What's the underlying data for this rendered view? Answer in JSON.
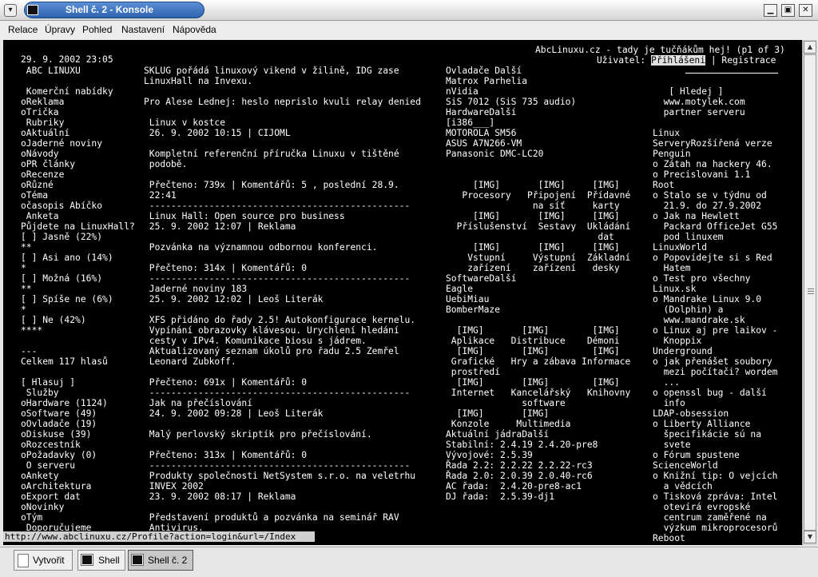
{
  "window": {
    "title": "Shell č. 2 - Konsole"
  },
  "menu": [
    "Relace",
    "Úpravy",
    "Pohled",
    "Nastavení",
    "Nápověda"
  ],
  "taskbar": {
    "new_label": "Vytvořit",
    "tabs": [
      "Shell",
      "Shell č. 2"
    ]
  },
  "status_url": "http://www.abclinuxu.cz/Profile?action=login&url=/Index",
  "header": {
    "site": "AbcLinuxu.cz - tady je tučňákům hej! (p1 of 3)",
    "date": "29. 9. 2002 23:05",
    "user_label": "Uživatel: ",
    "login": "Přihlášeni",
    "register": " | Registrace"
  },
  "left": [
    " ABC LINUXU",
    "",
    " Komerční nabídky",
    "oReklama",
    "oTrička",
    " Rubriky",
    "oAktuální",
    "oJaderné noviny",
    "oNávody",
    "oPR články",
    "oRecenze",
    "oRůzné",
    "oTéma",
    "očasopis Abíčko",
    " Anketa",
    "Půjdete na LinuxHall?",
    "[ ] Jasně (22%)",
    "**",
    "[ ] Asi ano (14%)",
    "*",
    "[ ] Možná (16%)",
    "**",
    "[ ] Spíše ne (6%)",
    "*",
    "[ ] Ne (42%)",
    "****",
    "",
    "---",
    "Celkem 117 hlasů",
    "",
    "[ Hlasuj ]",
    " Služby",
    "oHardware (1124)",
    "oSoftware (49)",
    "oOvladače (19)",
    "oDiskuse (39)",
    "oRozcestník",
    "oPožadavky (0)",
    " O serveru",
    "oAnkety",
    "oArchitektura",
    "oExport dat",
    "oNovinky",
    "oTým",
    " Doporučujeme"
  ],
  "center": [
    "SKLUG pořádá linuxový vikend v žilině, IDG zase",
    "LinuxHall na Invexu.",
    "",
    "Pro Alese Lednej: heslo neprislo kvuli relay denied",
    "",
    " Linux v kostce",
    " 26. 9. 2002 10:15 | CIJOML",
    "",
    " Kompletní referenční příručka Linuxu v tištěné",
    " podobě.",
    "",
    " Přečteno: 739x | Komentářů: 5 , poslední 28.9.",
    " 22:41",
    " ------------------------------------------------",
    " Linux Hall: Open source pro business",
    " 25. 9. 2002 12:07 | Reklama",
    "",
    " Pozvánka na významnou odbornou konferenci.",
    "",
    " Přečteno: 314x | Komentářů: 0",
    " ------------------------------------------------",
    " Jaderné noviny 183",
    " 25. 9. 2002 12:02 | Leoš Literák",
    "",
    " XFS přidáno do řady 2.5! Autokonfigurace kernelu.",
    " Vypínání obrazovky klávesou. Urychlení hledání",
    " cesty v IPv4. Komunikace biosu s jádrem.",
    " Aktualizovaný seznam úkolů pro řadu 2.5 Zemřel",
    " Leonard Zubkoff.",
    "",
    " Přečteno: 691x | Komentářů: 0",
    " ------------------------------------------------",
    " Jak na přečíslování",
    " 24. 9. 2002 09:28 | Leoš Literák",
    "",
    " Malý perlovský skriptík pro přečíslování.",
    "",
    " Přečteno: 313x | Komentářů: 0",
    " ------------------------------------------------",
    " Produkty společnosti NetSystem s.r.o. na veletrhu",
    " INVEX 2002",
    " 23. 9. 2002 08:17 | Reklama",
    "",
    " Představení produktů a pozvánka na seminář RAV",
    " Antivirus."
  ],
  "hw": [
    "Ovladače Další",
    "Matrox Parhelia",
    "nVidia",
    "SiS 7012 (SiS 735 audio)",
    "HardwareDalší",
    "[i386___]",
    "MOTOROLA SM56",
    "ASUS A7N266-VM",
    "Panasonic DMC-LC20",
    "",
    "",
    "     [IMG]       [IMG]     [IMG]",
    "   Procesory   Připojení  Přídavné",
    "                na síť     karty",
    "     [IMG]       [IMG]     [IMG]",
    "  Příslušenství  Sestavy  Ukládání",
    "                            dat",
    "     [IMG]       [IMG]     [IMG]",
    "    Vstupní     Výstupní  Základní",
    "    zařízení    zařízení   desky",
    "SoftwareDalší",
    "Eagle",
    "UebiMiau",
    "BomberMaze",
    "",
    "  [IMG]       [IMG]        [IMG]",
    " Aplikace   Distribuce    Démoni",
    "  [IMG]       [IMG]        [IMG]",
    " Grafické   Hry a zábava Informace",
    " prostředí",
    "  [IMG]       [IMG]        [IMG]",
    " Internet   Kancelářský   Knihovny",
    "              software",
    "  [IMG]       [IMG]",
    " Konzole     Multimedia",
    "Aktuální jádraDalší",
    "Stabilní: 2.4.19 2.4.20-pre8",
    "Vývojové: 2.5.39",
    "Řada 2.2: 2.2.22 2.2.22-rc3",
    "Řada 2.0: 2.0.39 2.0.40-rc6",
    "AC řada:  2.4.20-pre8-ac1",
    "DJ řada:  2.5.39-dj1"
  ],
  "right": [
    "",
    "",
    "   [ Hledej ]",
    "  www.motylek.com",
    "  partner serveru",
    "",
    "Linux",
    "ServeryRozšířená verze",
    "Penguin",
    "o Zátah na hackery 46.",
    "o Precislovani 1.1",
    "Root",
    "o Stalo se v týdnu od",
    "  21.9. do 27.9.2002",
    "o Jak na Hewlett",
    "  Packard OfficeJet G55",
    "  pod linuxem",
    "LinuxWorld",
    "o Popovídejte si s Red",
    "  Hatem",
    "o Test pro všechny",
    "Linux.sk",
    "o Mandrake Linux 9.0",
    "  (Dolphin) a",
    "  www.mandrake.sk",
    "o Linux aj pre laikov -",
    "  Knoppix",
    "Underground",
    "o jak přenášet soubory",
    "  mezi počítači? wordem",
    "  ...",
    "o openssl bug - další",
    "  info",
    "LDAP-obsession",
    "o Liberty Alliance",
    "  špecifikácie sú na",
    "  svete",
    "o Fórum spustene",
    "ScienceWorld",
    "o Knižní tip: O vejcích",
    "  a vědcích",
    "o Tisková zpráva: Intel",
    "  otevírá evropské",
    "  centrum zaměřené na",
    "  výzkum mikroprocesorů",
    "Reboot"
  ]
}
